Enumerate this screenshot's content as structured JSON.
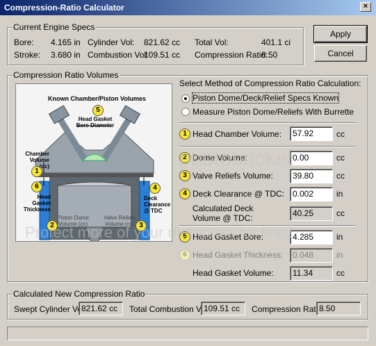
{
  "window": {
    "title": "Compression-Ratio Calculator",
    "close": "×"
  },
  "buttons": {
    "apply": "Apply",
    "cancel": "Cancel"
  },
  "engine": {
    "legend": "Current Engine Specs",
    "bore_label": "Bore:",
    "bore_value": "4.165 in",
    "stroke_label": "Stroke:",
    "stroke_value": "3.680 in",
    "cyl_label": "Cylinder Vol:",
    "cyl_value": "821.62 cc",
    "comb_label": "Combustion Vol:",
    "comb_value": "109.51 cc",
    "total_label": "Total Vol:",
    "total_value": "401.1 ci",
    "cr_label": "Compression Ratio:",
    "cr_value": "8.50"
  },
  "volumes": {
    "legend": "Compression Ratio Volumes",
    "method_label": "Select Method of Compression Ratio Calculation:",
    "method_options": [
      "Piston Dome/Deck/Relief Specs Known",
      "Measure Piston Dome/Reliefs With Burrette"
    ],
    "selected_method": 0,
    "fields": [
      {
        "num": "1",
        "label": "Head Chamber Volume:",
        "value": "57.92",
        "unit": "cc"
      },
      {
        "num": "2",
        "label": "Dome Volume:",
        "value": "0.00",
        "unit": "cc"
      },
      {
        "num": "3",
        "label": "Valve Reliefs Volume:",
        "value": "39.80",
        "unit": "cc"
      },
      {
        "num": "4",
        "label": "Deck Clearance @ TDC:",
        "value": "0.002",
        "unit": "in"
      },
      {
        "num": "",
        "label": "Calculated Deck Volume @ TDC:",
        "value": "40.25",
        "unit": "cc"
      },
      {
        "num": "5",
        "label": "Head Gasket Bore:",
        "value": "4.285",
        "unit": "in"
      },
      {
        "num": "6",
        "label": "Head Gasket Thickness:",
        "value": "0.048",
        "unit": "in"
      },
      {
        "num": "",
        "label": "Head Gasket Volume:",
        "value": "11.34",
        "unit": "cc"
      }
    ]
  },
  "diagram": {
    "title": "Known Chamber/Piston Volumes",
    "labels": {
      "gasket_bore": "Head Gasket Bore Diameter",
      "chamber": "Chamber Volume (cc)",
      "gasket_thick": "Head Gasket Thickness",
      "deck": "Deck Clearance @ TDC",
      "dome": "Piston Dome Volume (cc)",
      "reliefs": "Valve Reliefs Volume (cc)"
    },
    "nums": [
      "1",
      "2",
      "3",
      "4",
      "5",
      "6"
    ]
  },
  "result": {
    "legend": "Calculated New Compression Ratio",
    "swept_label": "Swept Cylinder Vol:",
    "swept_value": "821.62 cc",
    "total_label": "Total Combustion Vol:",
    "total_value": "109.51 cc",
    "cr_label": "Compression Ratio:",
    "cr_value": "8.50"
  },
  "watermark": {
    "line1": "photobucket",
    "line2": "Protect more of your memories for less!"
  }
}
